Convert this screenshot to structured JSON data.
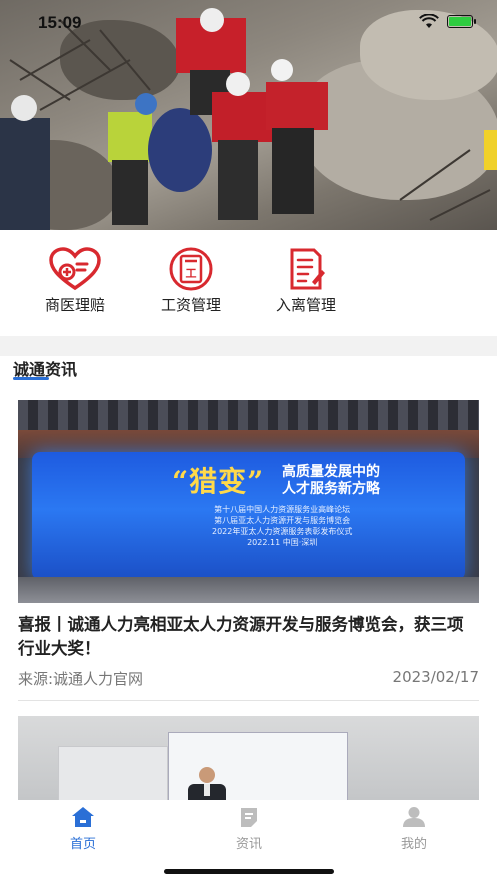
{
  "status_bar": {
    "time": "15:09"
  },
  "quick_menu": [
    {
      "label": "商医理赔",
      "icon": "heart-medical-icon"
    },
    {
      "label": "工资管理",
      "icon": "salary-document-icon"
    },
    {
      "label": "入离管理",
      "icon": "onboarding-document-icon"
    }
  ],
  "section": {
    "title": "诚通资讯"
  },
  "news": [
    {
      "title": "喜报丨诚通人力亮相亚太人力资源开发与服务博览会，获三项行业大奖！",
      "source": "来源:诚通人力官网",
      "date": "2023/02/17",
      "image_text": {
        "headline": "“猎变”",
        "headline_right": [
          "高质量发展中的",
          "人才服务新方略"
        ],
        "lines": [
          "第十八届中国人力资源服务业高峰论坛",
          "第八届亚太人力资源开发与服务博览会",
          "2022年亚太人力资源服务表彰发布仪式",
          "2022.11  中国·深圳"
        ]
      }
    },
    {}
  ],
  "tab_bar": [
    {
      "label": "首页",
      "icon": "home-icon",
      "active": true
    },
    {
      "label": "资讯",
      "icon": "news-icon",
      "active": false
    },
    {
      "label": "我的",
      "icon": "profile-icon",
      "active": false
    }
  ],
  "colors": {
    "brand_red": "#d8292f",
    "accent_blue": "#2a6fd6",
    "inactive_gray": "#999999"
  }
}
